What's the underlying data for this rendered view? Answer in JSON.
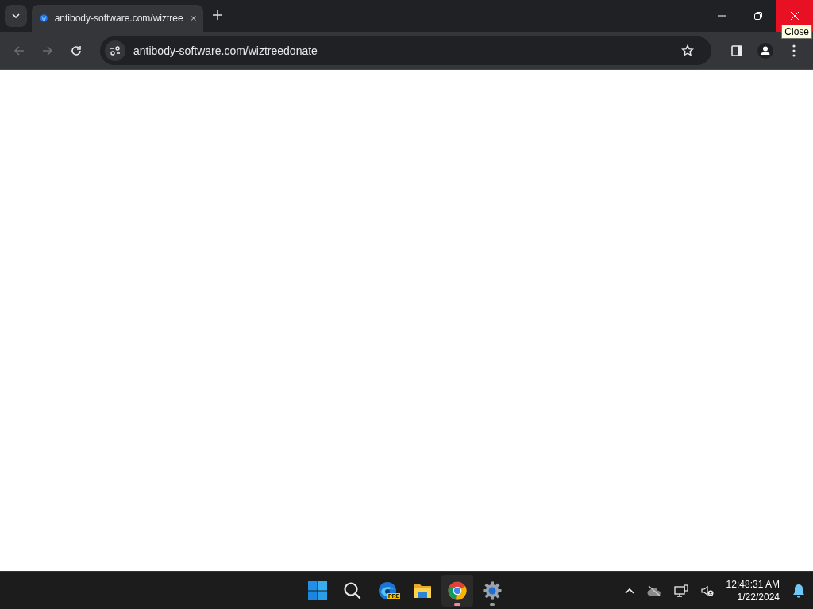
{
  "tab_strip": {
    "tabs": [
      {
        "title": "antibody-software.com/wiztree",
        "selected": true
      }
    ],
    "window_controls": [
      {
        "kind": "minimize",
        "hovered": false
      },
      {
        "kind": "restore",
        "hovered": false
      },
      {
        "kind": "close",
        "hovered": true
      }
    ],
    "tooltip": "Close"
  },
  "toolbar": {
    "back_enabled": false,
    "forward_enabled": false,
    "address": "antibody-software.com/wiztreedonate"
  },
  "taskbar": {
    "apps": [
      {
        "kind": "start",
        "open": false,
        "focused": false
      },
      {
        "kind": "search",
        "open": false,
        "focused": false
      },
      {
        "kind": "edge",
        "badge": "PRE",
        "open": false,
        "focused": false
      },
      {
        "kind": "explorer",
        "open": false,
        "focused": false
      },
      {
        "kind": "chrome",
        "open": true,
        "focused": true
      },
      {
        "kind": "settings",
        "open": true,
        "focused": false
      }
    ],
    "time": "12:48:31 AM",
    "date": "1/22/2024"
  }
}
